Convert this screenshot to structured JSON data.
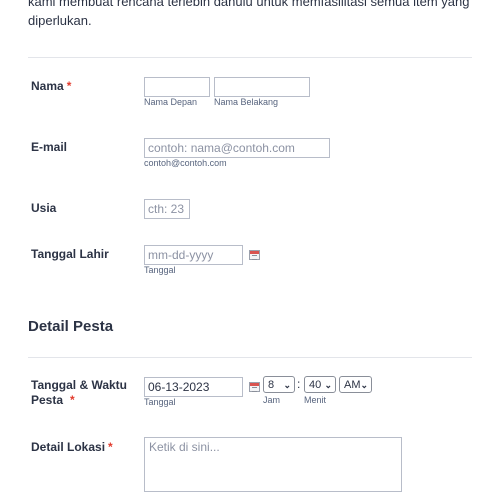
{
  "intro": {
    "line1": "kami membuat rencana terlebih dahulu untuk memfasilitasi semua item yang",
    "line2": "diperlukan."
  },
  "fields": {
    "nama": {
      "label": "Nama",
      "required_mark": "*",
      "first_sublabel": "Nama Depan",
      "last_sublabel": "Nama Belakang",
      "first_value": "",
      "last_value": ""
    },
    "email": {
      "label": "E-mail",
      "placeholder": "contoh: nama@contoh.com",
      "sublabel": "contoh@contoh.com",
      "value": ""
    },
    "usia": {
      "label": "Usia",
      "placeholder": "cth: 23",
      "value": ""
    },
    "tanggal_lahir": {
      "label": "Tanggal Lahir",
      "placeholder": "mm-dd-yyyy",
      "sublabel": "Tanggal",
      "value": ""
    }
  },
  "section": {
    "title": "Detail Pesta"
  },
  "party": {
    "datetime": {
      "label_line1": "Tanggal & Waktu",
      "label_line2": "Pesta",
      "required_mark": "*",
      "date_value": "06-13-2023",
      "date_sublabel": "Tanggal",
      "hour_value": "8",
      "hour_sublabel": "Jam",
      "colon": ":",
      "minute_value": "40",
      "minute_sublabel": "Menit",
      "ampm_value": "AM"
    },
    "location": {
      "label": "Detail Lokasi",
      "required_mark": "*",
      "placeholder": "Ketik di sini..."
    }
  },
  "icons": {
    "calendar": "calendar-icon",
    "chevron": "chevron-down-icon"
  },
  "colors": {
    "required": "#e23b2d",
    "text": "#2c3345",
    "divider": "#e3e5ea",
    "input_border": "#b8bdc9"
  }
}
